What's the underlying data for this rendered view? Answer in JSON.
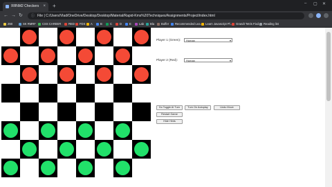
{
  "browser": {
    "tab_title": "ЯЯNM2 Checkers",
    "tab_close": "×",
    "new_tab": "+",
    "window_controls": [
      "–",
      "▢",
      "✕"
    ],
    "url": "File  |  C:/Users/Vlad/OneDrive/Desktop/Desktop/Material/Rapid-Kms%20Techniques/Assignments/Project/index.html",
    "nav": [
      "←",
      "→",
      "↻"
    ],
    "bookmarks": [
      {
        "label": "Z60",
        "color": "#e8c842"
      },
      {
        "label": "SK RMRF",
        "color": "#5b9bd5"
      },
      {
        "label": "CSS CAREER",
        "color": "#3cba54"
      },
      {
        "label": "RED",
        "color": "#db4437"
      },
      {
        "label": "FDS",
        "color": "#db4437"
      },
      {
        "label": "A",
        "color": "#f4b400"
      },
      {
        "label": "B",
        "color": "#4285f4"
      },
      {
        "label": "C",
        "color": "#0f9d58"
      },
      {
        "label": "D",
        "color": "#db4437"
      },
      {
        "label": "E",
        "color": "#4285f4"
      },
      {
        "label": "Lab",
        "color": "#ab47bc"
      },
      {
        "label": "Bla",
        "color": "#26a69a"
      },
      {
        "label": "Buffer",
        "color": "#8d6e63"
      },
      {
        "label": "Recommended Lea…",
        "color": "#4285f4"
      },
      {
        "label": "Learn Javascript Pl…",
        "color": "#f4b400"
      },
      {
        "label": "Grandt Tetris Fixd…",
        "color": "#db4437"
      },
      {
        "label": "Reading list",
        "color": "#9aa0a6"
      }
    ]
  },
  "board": {
    "rows": [
      [
        0,
        1,
        0,
        1,
        0,
        1,
        0,
        1
      ],
      [
        1,
        0,
        1,
        0,
        1,
        0,
        1,
        0
      ],
      [
        0,
        1,
        0,
        1,
        0,
        1,
        0,
        1
      ],
      [
        0,
        0,
        0,
        0,
        0,
        0,
        0,
        0
      ],
      [
        0,
        0,
        0,
        0,
        0,
        0,
        0,
        0
      ],
      [
        2,
        0,
        2,
        0,
        2,
        0,
        2,
        0
      ],
      [
        0,
        2,
        0,
        2,
        0,
        2,
        0,
        2
      ],
      [
        2,
        0,
        2,
        0,
        2,
        0,
        2,
        0
      ]
    ],
    "piece_colors": {
      "red": "#f44a36",
      "green": "#21e16a"
    }
  },
  "controls": {
    "player1_label": "Player 1 (Green):",
    "player1_value": "Human",
    "player2_label": "Player 2 (Red):",
    "player2_value": "Human",
    "buttons": {
      "toggle_ai": "Do Toggle AI Turn",
      "turn_on_autoplay": "Turn On Autoplay",
      "undo_move": "Undo Move",
      "restart_game": "Restart Game",
      "hide_hints": "Hide Hints"
    }
  }
}
